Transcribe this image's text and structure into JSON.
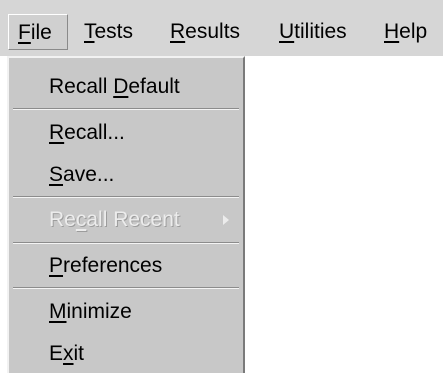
{
  "menubar": {
    "items": [
      {
        "pre": "",
        "mn": "F",
        "post": "ile"
      },
      {
        "pre": "",
        "mn": "T",
        "post": "ests"
      },
      {
        "pre": "",
        "mn": "R",
        "post": "esults"
      },
      {
        "pre": "",
        "mn": "U",
        "post": "tilities"
      },
      {
        "pre": "",
        "mn": "H",
        "post": "elp"
      }
    ]
  },
  "file_menu": {
    "items": [
      {
        "pre": "Recall ",
        "mn": "D",
        "post": "efault",
        "enabled": true
      },
      {
        "pre": "",
        "mn": "R",
        "post": "ecall...",
        "enabled": true
      },
      {
        "pre": "",
        "mn": "S",
        "post": "ave...",
        "enabled": true
      },
      {
        "pre": "Re",
        "mn": "c",
        "post": "all Recent",
        "enabled": false,
        "submenu": true
      },
      {
        "pre": "",
        "mn": "P",
        "post": "references",
        "enabled": true
      },
      {
        "pre": "",
        "mn": "M",
        "post": "inimize",
        "enabled": true
      },
      {
        "pre": "E",
        "mn": "x",
        "post": "it",
        "enabled": true
      }
    ]
  }
}
